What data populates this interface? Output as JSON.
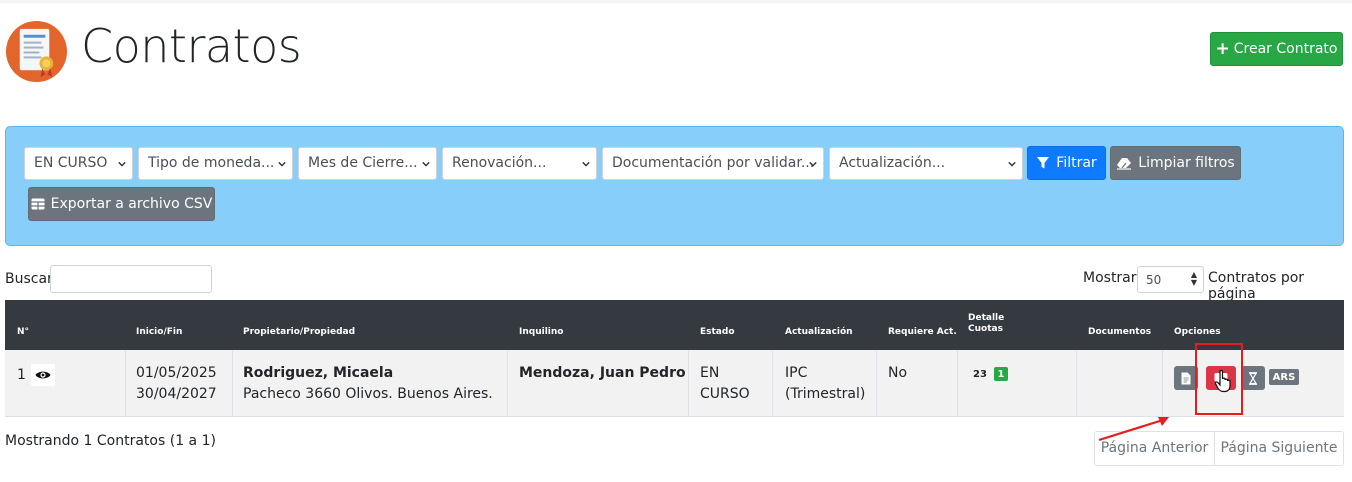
{
  "header": {
    "title": "Contratos",
    "create_button": "Crear Contrato"
  },
  "filters": {
    "estado": "EN CURSO",
    "moneda": "Tipo de moneda...",
    "mes_cierre": "Mes de Cierre...",
    "renovacion": "Renovación...",
    "documentacion": "Documentación por validar...",
    "actualizacion": "Actualización...",
    "filter_button": "Filtrar",
    "clear_button": "Limpiar filtros",
    "export_button": "Exportar a archivo CSV"
  },
  "search": {
    "label": "Buscar",
    "value": ""
  },
  "paging": {
    "show_label": "Mostrar",
    "page_size": "50",
    "per_page_label": "Contratos por página"
  },
  "table": {
    "headers": {
      "num": "N°",
      "dates": "Inicio/Fin",
      "owner": "Propietario/Propiedad",
      "tenant": "Inquilino",
      "status": "Estado",
      "update": "Actualización",
      "requires": "Requiere Act.",
      "installments_1": "Detalle",
      "installments_2": "Cuotas",
      "documents": "Documentos",
      "options": "Opciones"
    },
    "rows": [
      {
        "num": "1",
        "start": "01/05/2025",
        "end": "30/04/2027",
        "owner": "Rodriguez, Micaela",
        "property": "Pacheco 3660 Olivos. Buenos Aires.",
        "tenant": "Mendoza, Juan Pedro",
        "status_1": "EN",
        "status_2": "CURSO",
        "update_1": "IPC",
        "update_2": "(Trimestral)",
        "requires": "No",
        "installments_count": "23",
        "installments_badge": "1",
        "currency": "ARS"
      }
    ]
  },
  "footer": {
    "showing": "Mostrando 1 Contratos (1 a 1)",
    "prev": "Página Anterior",
    "next": "Página Siguiente"
  },
  "colors": {
    "primary": "#0d7aff",
    "success": "#28a745",
    "danger": "#dc3545",
    "secondary": "#6c757d",
    "filter_panel": "#87cefa",
    "table_header": "#343a40",
    "annotation": "#e41e1e"
  },
  "icons": {
    "page": "contract-document-icon",
    "filter": "funnel-icon",
    "clear": "eraser-icon",
    "export": "table-icon",
    "view": "eye-icon",
    "doc": "file-icon",
    "delete": "comment-delete-icon",
    "history": "hourglass-icon",
    "cursor": "hand-pointer-icon"
  }
}
